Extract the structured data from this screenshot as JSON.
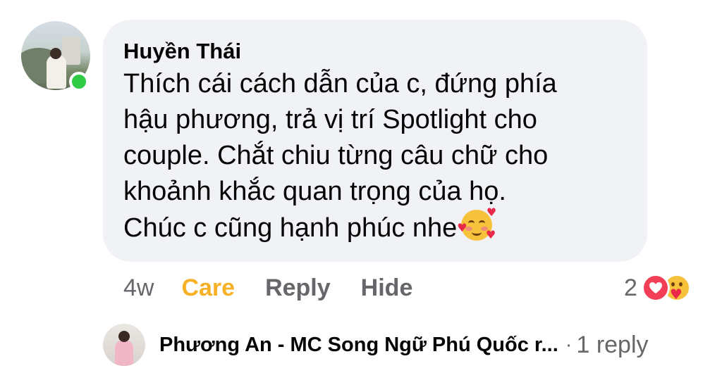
{
  "comment": {
    "author": "Huyền Thái",
    "text": "Thích cái cách dẫn của c, đứng phía\nhậu phương, trả vị trí Spotlight cho\ncouple. Chắt chiu từng câu chữ cho\nkhoảnh khắc quan trọng của họ.\nChúc c cũng hạnh phúc nhe",
    "emoji": "smiling-face-with-hearts",
    "online": true
  },
  "actions": {
    "time": "4w",
    "care_label": "Care",
    "reply_label": "Reply",
    "hide_label": "Hide"
  },
  "reactions": {
    "count": "2",
    "types": [
      "love",
      "care"
    ],
    "colors": {
      "love": "#f33e58",
      "care": "#f7c23b",
      "care_text": "#f7b125"
    }
  },
  "reply_preview": {
    "author": "Phương An - MC Song Ngữ Phú Quốc r...",
    "separator": "·",
    "count_label": "1 reply"
  }
}
